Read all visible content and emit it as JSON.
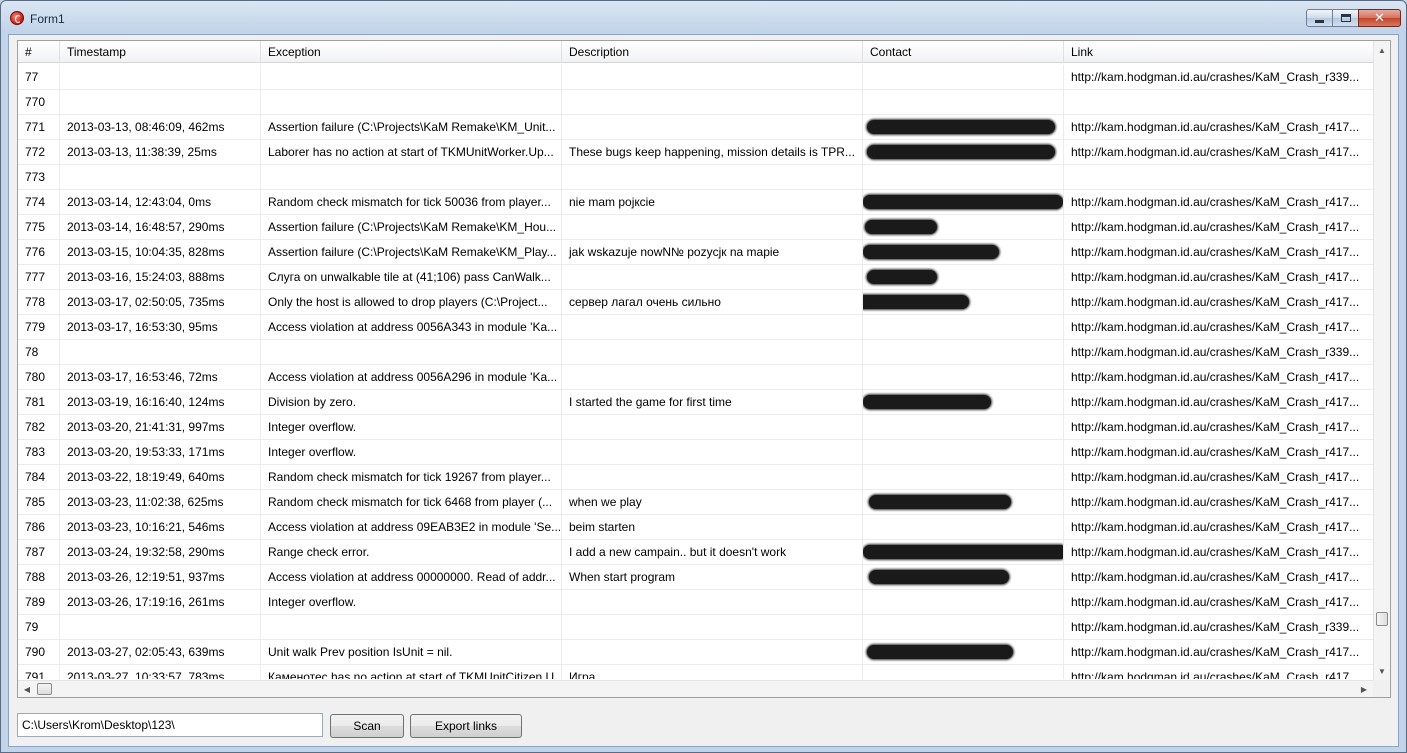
{
  "window": {
    "title": "Form1",
    "icon": "app-icon",
    "caption_icons": [
      "minimize-icon",
      "maximize-icon",
      "close-icon"
    ],
    "close_glyph": "✕"
  },
  "grid": {
    "columns": [
      "#",
      "Timestamp",
      "Exception",
      "Description",
      "Contact",
      "Link"
    ],
    "rows": [
      {
        "num": "77",
        "timestamp": "",
        "exception": "",
        "description": "",
        "contact_redacted": false,
        "link": "http://kam.hodgman.id.au/crashes/KaM_Crash_r339..."
      },
      {
        "num": "770",
        "timestamp": "",
        "exception": "",
        "description": "",
        "contact_redacted": false,
        "link": ""
      },
      {
        "num": "771",
        "timestamp": "2013-03-13, 08:46:09, 462ms",
        "exception": "Assertion failure (C:\\Projects\\KaM Remake\\KM_Unit...",
        "description": "",
        "contact_redacted": true,
        "link": "http://kam.hodgman.id.au/crashes/KaM_Crash_r417..."
      },
      {
        "num": "772",
        "timestamp": "2013-03-13, 11:38:39, 25ms",
        "exception": "Laborer has no action at start of TKMUnitWorker.Up...",
        "description": "These bugs keep happening, mission details is TPR...",
        "contact_redacted": true,
        "link": "http://kam.hodgman.id.au/crashes/KaM_Crash_r417..."
      },
      {
        "num": "773",
        "timestamp": "",
        "exception": "",
        "description": "",
        "contact_redacted": false,
        "link": ""
      },
      {
        "num": "774",
        "timestamp": "2013-03-14, 12:43:04, 0ms",
        "exception": "Random check mismatch for tick 50036 from player...",
        "description": "nie mam pojкcie",
        "contact_redacted": true,
        "link": "http://kam.hodgman.id.au/crashes/KaM_Crash_r417..."
      },
      {
        "num": "775",
        "timestamp": "2013-03-14, 16:48:57, 290ms",
        "exception": "Assertion failure (C:\\Projects\\KaM Remake\\KM_Hou...",
        "description": "",
        "contact_redacted": true,
        "link": "http://kam.hodgman.id.au/crashes/KaM_Crash_r417..."
      },
      {
        "num": "776",
        "timestamp": "2013-03-15, 10:04:35, 828ms",
        "exception": "Assertion failure (C:\\Projects\\KaM Remake\\KM_Play...",
        "description": "jak wskazuje nowN№ pozycjк na mapie",
        "contact_redacted": true,
        "link": "http://kam.hodgman.id.au/crashes/KaM_Crash_r417..."
      },
      {
        "num": "777",
        "timestamp": "2013-03-16, 15:24:03, 888ms",
        "exception": "Слуга on unwalkable tile at (41;106) pass CanWalk...",
        "description": "",
        "contact_redacted": true,
        "link": "http://kam.hodgman.id.au/crashes/KaM_Crash_r417..."
      },
      {
        "num": "778",
        "timestamp": "2013-03-17, 02:50:05, 735ms",
        "exception": "Only the host is allowed to drop players (C:\\Project...",
        "description": "сервер лагал очень сильно",
        "contact_redacted": true,
        "link": "http://kam.hodgman.id.au/crashes/KaM_Crash_r417..."
      },
      {
        "num": "779",
        "timestamp": "2013-03-17, 16:53:30, 95ms",
        "exception": "Access violation at address 0056A343 in module 'Ka...",
        "description": "",
        "contact_redacted": false,
        "link": "http://kam.hodgman.id.au/crashes/KaM_Crash_r417..."
      },
      {
        "num": "78",
        "timestamp": "",
        "exception": "",
        "description": "",
        "contact_redacted": false,
        "link": "http://kam.hodgman.id.au/crashes/KaM_Crash_r339..."
      },
      {
        "num": "780",
        "timestamp": "2013-03-17, 16:53:46, 72ms",
        "exception": "Access violation at address 0056A296 in module 'Ka...",
        "description": "",
        "contact_redacted": false,
        "link": "http://kam.hodgman.id.au/crashes/KaM_Crash_r417..."
      },
      {
        "num": "781",
        "timestamp": "2013-03-19, 16:16:40, 124ms",
        "exception": "Division by zero.",
        "description": "I started the game for first time",
        "contact_redacted": true,
        "link": "http://kam.hodgman.id.au/crashes/KaM_Crash_r417..."
      },
      {
        "num": "782",
        "timestamp": "2013-03-20, 21:41:31, 997ms",
        "exception": "Integer overflow.",
        "description": "",
        "contact_redacted": false,
        "link": "http://kam.hodgman.id.au/crashes/KaM_Crash_r417..."
      },
      {
        "num": "783",
        "timestamp": "2013-03-20, 19:53:33, 171ms",
        "exception": "Integer overflow.",
        "description": "",
        "contact_redacted": false,
        "link": "http://kam.hodgman.id.au/crashes/KaM_Crash_r417..."
      },
      {
        "num": "784",
        "timestamp": "2013-03-22, 18:19:49, 640ms",
        "exception": "Random check mismatch for tick 19267 from player...",
        "description": "",
        "contact_redacted": false,
        "link": "http://kam.hodgman.id.au/crashes/KaM_Crash_r417..."
      },
      {
        "num": "785",
        "timestamp": "2013-03-23, 11:02:38, 625ms",
        "exception": "Random check mismatch for tick 6468 from player (...",
        "description": "when we play",
        "contact_redacted": true,
        "link": "http://kam.hodgman.id.au/crashes/KaM_Crash_r417..."
      },
      {
        "num": "786",
        "timestamp": "2013-03-23, 10:16:21, 546ms",
        "exception": "Access violation at address 09EAB3E2 in module 'Se...",
        "description": "beim starten",
        "contact_redacted": false,
        "link": "http://kam.hodgman.id.au/crashes/KaM_Crash_r417..."
      },
      {
        "num": "787",
        "timestamp": "2013-03-24, 19:32:58, 290ms",
        "exception": "Range check error.",
        "description": "I add a new campain.. but it doesn't work",
        "contact_redacted": true,
        "link": "http://kam.hodgman.id.au/crashes/KaM_Crash_r417..."
      },
      {
        "num": "788",
        "timestamp": "2013-03-26, 12:19:51, 937ms",
        "exception": "Access violation at address 00000000. Read of addr...",
        "description": "When start program",
        "contact_redacted": true,
        "link": "http://kam.hodgman.id.au/crashes/KaM_Crash_r417..."
      },
      {
        "num": "789",
        "timestamp": "2013-03-26, 17:19:16, 261ms",
        "exception": "Integer overflow.",
        "description": "",
        "contact_redacted": false,
        "link": "http://kam.hodgman.id.au/crashes/KaM_Crash_r417..."
      },
      {
        "num": "79",
        "timestamp": "",
        "exception": "",
        "description": "",
        "contact_redacted": false,
        "link": "http://kam.hodgman.id.au/crashes/KaM_Crash_r339..."
      },
      {
        "num": "790",
        "timestamp": "2013-03-27, 02:05:43, 639ms",
        "exception": "Unit walk Prev position IsUnit = nil.",
        "description": "",
        "contact_redacted": true,
        "link": "http://kam.hodgman.id.au/crashes/KaM_Crash_r417..."
      },
      {
        "num": "791",
        "timestamp": "2013-03-27, 10:33:57, 783ms",
        "exception": "Каменотес has no action at start of TKMUnitCitizen.U...",
        "description": "Игра",
        "contact_redacted": false,
        "link": "http://kam.hodgman.id.au/crashes/KaM_Crash_r417..."
      }
    ]
  },
  "scrollbars": {
    "up_glyph": "▲",
    "down_glyph": "▼",
    "left_glyph": "◀",
    "right_glyph": "▶"
  },
  "footer": {
    "path_value": "C:\\Users\\Krom\\Desktop\\123\\",
    "scan_label": "Scan",
    "export_label": "Export links"
  }
}
